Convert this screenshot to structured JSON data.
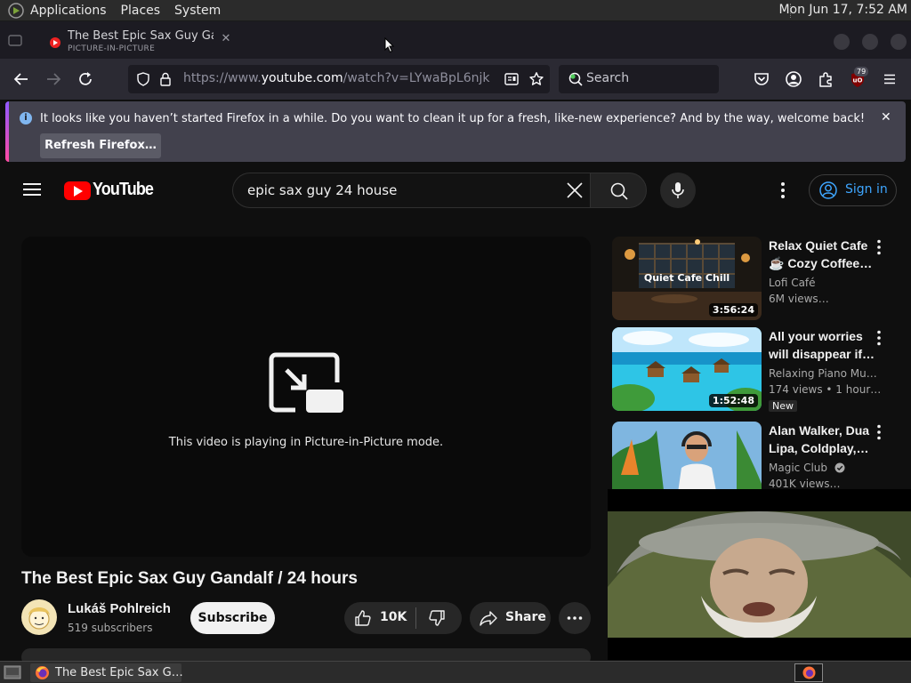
{
  "panel": {
    "menus": [
      "Applications",
      "Places",
      "System"
    ],
    "clock": "Mon Jun 17,  7:52 AM"
  },
  "tab": {
    "title": "The Best Epic Sax Guy Gandalf / 24 hours",
    "subtitle": "PICTURE-IN-PICTURE"
  },
  "navbar": {
    "url_prefix": "https://www.",
    "url_host": "youtube.com",
    "url_path": "/watch?v=LYwaBpL6njk",
    "search_placeholder": "Search",
    "extension_badge": "79"
  },
  "notification": {
    "message": "It looks like you haven’t started Firefox in a while. Do you want to clean it up for a fresh, like-new experience? And by the way, welcome back!",
    "button": "Refresh Firefox…"
  },
  "youtube": {
    "logo_text": "YouTube",
    "search_query": "epic sax guy 24 house",
    "sign_in": "Sign in",
    "pip_message": "This video is playing in Picture-in-Picture mode.",
    "video_title": "The Best Epic Sax Guy Gandalf / 24 hours",
    "channel_name": "Lukáš Pohlreich",
    "channel_subs": "519 subscribers",
    "subscribe": "Subscribe",
    "likes": "10K",
    "share": "Share"
  },
  "recommendations": [
    {
      "line1": "Relax Quiet Cafe",
      "line2": "☕ Cozy Coffee…",
      "channel": "Lofi Café",
      "views": "6M views…",
      "duration": "3:56:24",
      "thumb_text": "Quiet Cafe Chill"
    },
    {
      "line1": "All your worries",
      "line2": "will disappear if…",
      "channel": "Relaxing Piano Mu…",
      "views": "174 views  • 1 hour…",
      "duration": "1:52:48",
      "badge": "New"
    },
    {
      "line1": "Alan Walker, Dua",
      "line2": "Lipa, Coldplay,…",
      "channel": "Magic Club",
      "views": "401K views…"
    }
  ],
  "taskbar": {
    "window_title": "The Best Epic Sax G…"
  }
}
